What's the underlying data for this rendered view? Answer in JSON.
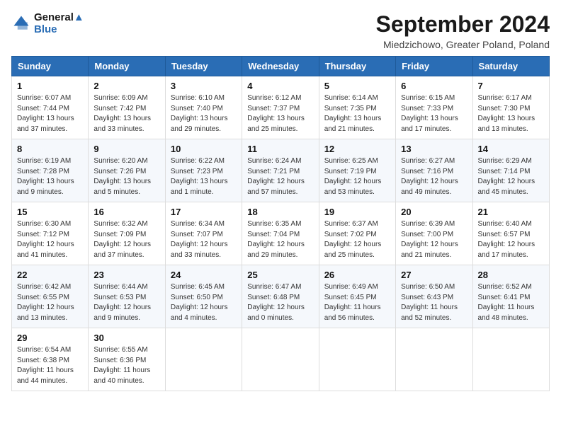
{
  "header": {
    "logo_line1": "General",
    "logo_line2": "Blue",
    "month_title": "September 2024",
    "location": "Miedzichowo, Greater Poland, Poland"
  },
  "weekdays": [
    "Sunday",
    "Monday",
    "Tuesday",
    "Wednesday",
    "Thursday",
    "Friday",
    "Saturday"
  ],
  "weeks": [
    [
      {
        "day": "1",
        "sunrise": "Sunrise: 6:07 AM",
        "sunset": "Sunset: 7:44 PM",
        "daylight": "Daylight: 13 hours and 37 minutes."
      },
      {
        "day": "2",
        "sunrise": "Sunrise: 6:09 AM",
        "sunset": "Sunset: 7:42 PM",
        "daylight": "Daylight: 13 hours and 33 minutes."
      },
      {
        "day": "3",
        "sunrise": "Sunrise: 6:10 AM",
        "sunset": "Sunset: 7:40 PM",
        "daylight": "Daylight: 13 hours and 29 minutes."
      },
      {
        "day": "4",
        "sunrise": "Sunrise: 6:12 AM",
        "sunset": "Sunset: 7:37 PM",
        "daylight": "Daylight: 13 hours and 25 minutes."
      },
      {
        "day": "5",
        "sunrise": "Sunrise: 6:14 AM",
        "sunset": "Sunset: 7:35 PM",
        "daylight": "Daylight: 13 hours and 21 minutes."
      },
      {
        "day": "6",
        "sunrise": "Sunrise: 6:15 AM",
        "sunset": "Sunset: 7:33 PM",
        "daylight": "Daylight: 13 hours and 17 minutes."
      },
      {
        "day": "7",
        "sunrise": "Sunrise: 6:17 AM",
        "sunset": "Sunset: 7:30 PM",
        "daylight": "Daylight: 13 hours and 13 minutes."
      }
    ],
    [
      {
        "day": "8",
        "sunrise": "Sunrise: 6:19 AM",
        "sunset": "Sunset: 7:28 PM",
        "daylight": "Daylight: 13 hours and 9 minutes."
      },
      {
        "day": "9",
        "sunrise": "Sunrise: 6:20 AM",
        "sunset": "Sunset: 7:26 PM",
        "daylight": "Daylight: 13 hours and 5 minutes."
      },
      {
        "day": "10",
        "sunrise": "Sunrise: 6:22 AM",
        "sunset": "Sunset: 7:23 PM",
        "daylight": "Daylight: 13 hours and 1 minute."
      },
      {
        "day": "11",
        "sunrise": "Sunrise: 6:24 AM",
        "sunset": "Sunset: 7:21 PM",
        "daylight": "Daylight: 12 hours and 57 minutes."
      },
      {
        "day": "12",
        "sunrise": "Sunrise: 6:25 AM",
        "sunset": "Sunset: 7:19 PM",
        "daylight": "Daylight: 12 hours and 53 minutes."
      },
      {
        "day": "13",
        "sunrise": "Sunrise: 6:27 AM",
        "sunset": "Sunset: 7:16 PM",
        "daylight": "Daylight: 12 hours and 49 minutes."
      },
      {
        "day": "14",
        "sunrise": "Sunrise: 6:29 AM",
        "sunset": "Sunset: 7:14 PM",
        "daylight": "Daylight: 12 hours and 45 minutes."
      }
    ],
    [
      {
        "day": "15",
        "sunrise": "Sunrise: 6:30 AM",
        "sunset": "Sunset: 7:12 PM",
        "daylight": "Daylight: 12 hours and 41 minutes."
      },
      {
        "day": "16",
        "sunrise": "Sunrise: 6:32 AM",
        "sunset": "Sunset: 7:09 PM",
        "daylight": "Daylight: 12 hours and 37 minutes."
      },
      {
        "day": "17",
        "sunrise": "Sunrise: 6:34 AM",
        "sunset": "Sunset: 7:07 PM",
        "daylight": "Daylight: 12 hours and 33 minutes."
      },
      {
        "day": "18",
        "sunrise": "Sunrise: 6:35 AM",
        "sunset": "Sunset: 7:04 PM",
        "daylight": "Daylight: 12 hours and 29 minutes."
      },
      {
        "day": "19",
        "sunrise": "Sunrise: 6:37 AM",
        "sunset": "Sunset: 7:02 PM",
        "daylight": "Daylight: 12 hours and 25 minutes."
      },
      {
        "day": "20",
        "sunrise": "Sunrise: 6:39 AM",
        "sunset": "Sunset: 7:00 PM",
        "daylight": "Daylight: 12 hours and 21 minutes."
      },
      {
        "day": "21",
        "sunrise": "Sunrise: 6:40 AM",
        "sunset": "Sunset: 6:57 PM",
        "daylight": "Daylight: 12 hours and 17 minutes."
      }
    ],
    [
      {
        "day": "22",
        "sunrise": "Sunrise: 6:42 AM",
        "sunset": "Sunset: 6:55 PM",
        "daylight": "Daylight: 12 hours and 13 minutes."
      },
      {
        "day": "23",
        "sunrise": "Sunrise: 6:44 AM",
        "sunset": "Sunset: 6:53 PM",
        "daylight": "Daylight: 12 hours and 9 minutes."
      },
      {
        "day": "24",
        "sunrise": "Sunrise: 6:45 AM",
        "sunset": "Sunset: 6:50 PM",
        "daylight": "Daylight: 12 hours and 4 minutes."
      },
      {
        "day": "25",
        "sunrise": "Sunrise: 6:47 AM",
        "sunset": "Sunset: 6:48 PM",
        "daylight": "Daylight: 12 hours and 0 minutes."
      },
      {
        "day": "26",
        "sunrise": "Sunrise: 6:49 AM",
        "sunset": "Sunset: 6:45 PM",
        "daylight": "Daylight: 11 hours and 56 minutes."
      },
      {
        "day": "27",
        "sunrise": "Sunrise: 6:50 AM",
        "sunset": "Sunset: 6:43 PM",
        "daylight": "Daylight: 11 hours and 52 minutes."
      },
      {
        "day": "28",
        "sunrise": "Sunrise: 6:52 AM",
        "sunset": "Sunset: 6:41 PM",
        "daylight": "Daylight: 11 hours and 48 minutes."
      }
    ],
    [
      {
        "day": "29",
        "sunrise": "Sunrise: 6:54 AM",
        "sunset": "Sunset: 6:38 PM",
        "daylight": "Daylight: 11 hours and 44 minutes."
      },
      {
        "day": "30",
        "sunrise": "Sunrise: 6:55 AM",
        "sunset": "Sunset: 6:36 PM",
        "daylight": "Daylight: 11 hours and 40 minutes."
      },
      null,
      null,
      null,
      null,
      null
    ]
  ]
}
